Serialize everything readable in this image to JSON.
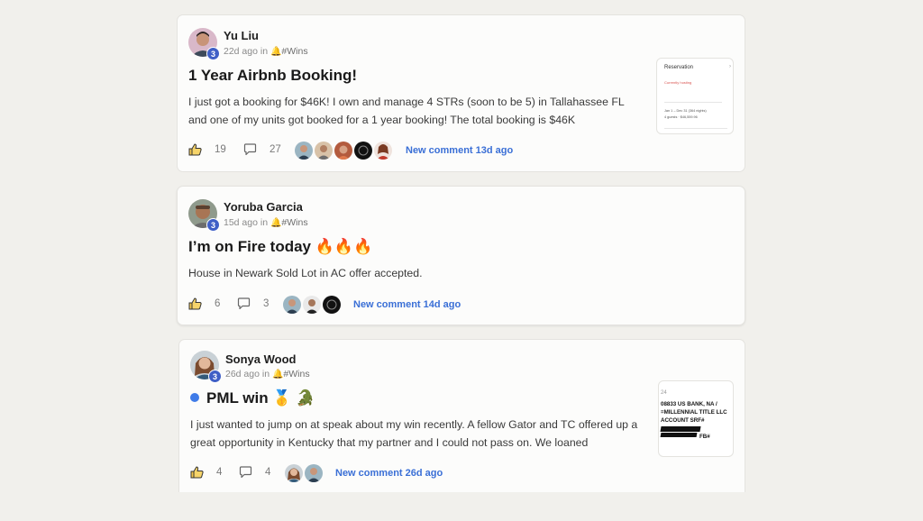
{
  "posts": [
    {
      "author": "Yu Liu",
      "level": "3",
      "time": "22d ago in",
      "channel": "#Wins",
      "title": "1 Year Airbnb Booking!",
      "body": "I just got a booking for $46K! I own and manage 4 STRs (soon to be 5) in Tallahassee FL and one of my units got booked for a 1 year booking! The total booking is $46K",
      "likes": "19",
      "comments": "27",
      "new_comment": "New comment 13d ago",
      "thumbnail": {
        "heading": "Reservation",
        "status": "Currently hosting",
        "dates": "Jan 1 – Dec 31 (364 nights)",
        "guests": "4 guests · $46,559.96"
      }
    },
    {
      "author": "Yoruba Garcia",
      "level": "3",
      "time": "15d ago in",
      "channel": "#Wins",
      "title": "I’m on Fire today 🔥🔥🔥",
      "body": "House in Newark Sold Lot in AC offer accepted.",
      "likes": "6",
      "comments": "3",
      "new_comment": "New comment 14d ago"
    },
    {
      "author": "Sonya Wood",
      "level": "3",
      "time": "26d ago in",
      "channel": "#Wins",
      "title": "PML win 🥇 🐊",
      "body": "I just wanted to jump on at speak about my win recently. A fellow Gator and TC offered up a great opportunity in Kentucky that my partner and I could not pass on. We loaned",
      "likes": "4",
      "comments": "4",
      "new_comment": "New comment 26d ago",
      "thumbnail": {
        "line0": "24",
        "line1": "08833 US BANK, NA /",
        "line2": "=MILLENNIAL TITLE LLC",
        "line3": "ACCOUNT SRF#",
        "line4": "FB#"
      }
    }
  ],
  "colors": {
    "background": "#f1f0ec",
    "card": "#fcfcfb",
    "badge": "#3f5fc6",
    "link": "#3a6fd6",
    "unread_dot": "#3f7be8"
  },
  "icons": [
    "like-icon",
    "comment-icon",
    "bell-icon"
  ]
}
